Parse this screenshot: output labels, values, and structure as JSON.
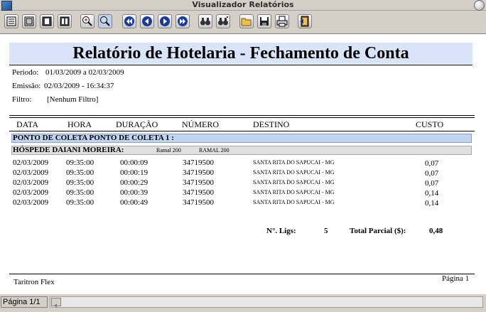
{
  "window": {
    "title": "Visualizador Relatórios"
  },
  "toolbar": {
    "buttons": [
      {
        "name": "list-view-icon"
      },
      {
        "name": "page-view-icon"
      },
      {
        "name": "single-page-icon"
      },
      {
        "name": "two-page-icon"
      },
      {
        "name": "zoom-in-icon"
      },
      {
        "name": "zoom-fit-icon"
      },
      {
        "name": "first-page-icon"
      },
      {
        "name": "prev-page-icon"
      },
      {
        "name": "next-page-icon"
      },
      {
        "name": "last-page-icon"
      },
      {
        "name": "find-icon"
      },
      {
        "name": "find-next-icon"
      },
      {
        "name": "open-icon"
      },
      {
        "name": "save-icon"
      },
      {
        "name": "print-icon"
      },
      {
        "name": "exit-icon"
      }
    ]
  },
  "report": {
    "title": "Relatório de Hotelaria - Fechamento de Conta",
    "periodo_label": "Periodo:",
    "periodo_value": "01/03/2009 a 02/03/2009",
    "emissao_label": "Emissão:",
    "emissao_value": "02/03/2009 - 16:34:37",
    "filtro_label": "Filtro:",
    "filtro_value": "[Nenhum Filtro]",
    "columns": {
      "data": "DATA",
      "hora": "HORA",
      "duracao": "DURAÇÃO",
      "numero": "NÚMERO",
      "destino": "DESTINO",
      "custo": "CUSTO"
    },
    "group_label": "PONTO DE COLETA   PONTO DE COLETA 1 :",
    "guest_label": "HÓSPEDE   DAIANI MOREIRA:",
    "guest_ramal1": "Ramal 200",
    "guest_ramal2": "RAMAL 200",
    "rows": [
      {
        "data": "02/03/2009",
        "hora": "09:35:00",
        "duracao": "00:00:09",
        "numero": "34719500",
        "destino": "SANTA RITA DO SAPUCAI - MG",
        "custo": "0,07"
      },
      {
        "data": "02/03/2009",
        "hora": "09:35:00",
        "duracao": "00:00:19",
        "numero": "34719500",
        "destino": "SANTA RITA DO SAPUCAI - MG",
        "custo": "0,07"
      },
      {
        "data": "02/03/2009",
        "hora": "09:35:00",
        "duracao": "00:00:29",
        "numero": "34719500",
        "destino": "SANTA RITA DO SAPUCAI - MG",
        "custo": "0,07"
      },
      {
        "data": "02/03/2009",
        "hora": "09:35:00",
        "duracao": "00:00:39",
        "numero": "34719500",
        "destino": "SANTA RITA DO SAPUCAI - MG",
        "custo": "0,14"
      },
      {
        "data": "02/03/2009",
        "hora": "09:35:00",
        "duracao": "00:00:49",
        "numero": "34719500",
        "destino": "SANTA RITA DO SAPUCAI - MG",
        "custo": "0,14"
      }
    ],
    "summary": {
      "ligs_label": "N°. Ligs:",
      "ligs_value": "5",
      "total_label": "Total Parcial ($):",
      "total_value": "0,48"
    },
    "footer": {
      "left": "Taritron Flex",
      "right": "Página 1"
    }
  },
  "statusbar": {
    "page": "Página 1/1"
  }
}
